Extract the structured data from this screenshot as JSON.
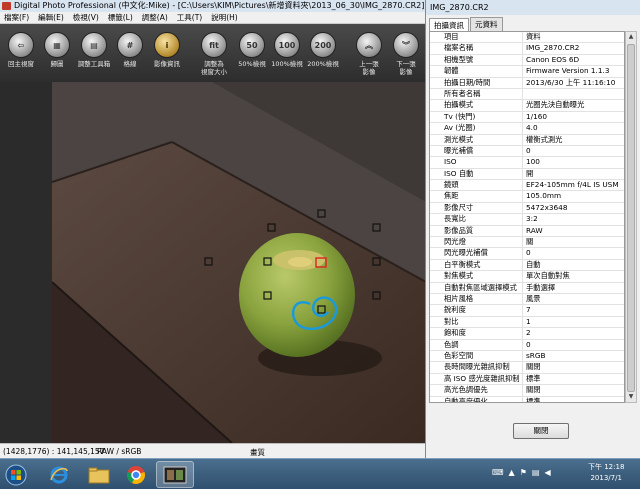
{
  "window": {
    "title": "Digital Photo Professional (中文化:Mike) - [C:\\Users\\KIM\\Pictures\\新增資料夾\\2013_06_30\\IMG_2870.CR2]"
  },
  "menu": [
    "檔案(F)",
    "編輯(E)",
    "檢視(V)",
    "標籤(L)",
    "調整(A)",
    "工具(T)",
    "說明(H)"
  ],
  "toolbar": {
    "buttons": [
      {
        "label": "回主視窗",
        "glyph": "⇦"
      },
      {
        "label": "歸圖",
        "glyph": "▦"
      },
      {
        "label": "調整工具箱",
        "glyph": "▤"
      },
      {
        "label": "格線",
        "glyph": "#"
      },
      {
        "label": "影像資訊",
        "glyph": "i"
      },
      {
        "label": "調整為\n視窗大小",
        "glyph": "fit"
      },
      {
        "label": "50%檢視",
        "glyph": "50"
      },
      {
        "label": "100%檢視",
        "glyph": "100"
      },
      {
        "label": "200%檢視",
        "glyph": "200"
      },
      {
        "label": "上一張\n影像",
        "glyph": "︽"
      },
      {
        "label": "下一張\n影像",
        "glyph": "︾"
      }
    ]
  },
  "status": {
    "coords": "(1428,1776) : 141,145,157",
    "profile": "RAW / sRGB",
    "quality": "畫質"
  },
  "info_panel": {
    "title": "IMG_2870.CR2",
    "tabs": [
      "拍攝資訊",
      "元資料"
    ],
    "header": {
      "key": "項目",
      "value": "資料"
    },
    "rows": [
      {
        "k": "檔案名稱",
        "v": "IMG_2870.CR2"
      },
      {
        "k": "相機型號",
        "v": "Canon EOS 6D"
      },
      {
        "k": "韌體",
        "v": "Firmware Version 1.1.3"
      },
      {
        "k": "拍攝日期/時間",
        "v": "2013/6/30 上午 11:16:10"
      },
      {
        "k": "所有者名稱",
        "v": ""
      },
      {
        "k": "拍攝模式",
        "v": "光圈先決自動曝光"
      },
      {
        "k": "Tv (快門)",
        "v": "1/160"
      },
      {
        "k": "Av (光圈)",
        "v": "4.0"
      },
      {
        "k": "測光模式",
        "v": "權衡式測光"
      },
      {
        "k": "曝光補償",
        "v": "0"
      },
      {
        "k": "ISO",
        "v": "100"
      },
      {
        "k": "ISO 自動",
        "v": "開"
      },
      {
        "k": "鏡頭",
        "v": "EF24-105mm f/4L IS USM"
      },
      {
        "k": "焦距",
        "v": "105.0mm"
      },
      {
        "k": "影像尺寸",
        "v": "5472x3648"
      },
      {
        "k": "長寬比",
        "v": "3:2"
      },
      {
        "k": "影像品質",
        "v": "RAW"
      },
      {
        "k": "閃光燈",
        "v": "關"
      },
      {
        "k": "閃光曝光補償",
        "v": "0"
      },
      {
        "k": "白平衡模式",
        "v": "自動"
      },
      {
        "k": "對焦模式",
        "v": "單次自動對焦"
      },
      {
        "k": "自動對焦區域選擇模式",
        "v": "手動選擇"
      },
      {
        "k": "相片風格",
        "v": "風景"
      },
      {
        "k": "銳利度",
        "v": "7"
      },
      {
        "k": "對比",
        "v": "1"
      },
      {
        "k": "飽和度",
        "v": "2"
      },
      {
        "k": "色調",
        "v": "0"
      },
      {
        "k": "色彩空間",
        "v": "sRGB"
      },
      {
        "k": "長時間曝光雜訊抑制",
        "v": "關閉"
      },
      {
        "k": "高 ISO 感光度雜訊抑制",
        "v": "標準"
      },
      {
        "k": "高光色調優先",
        "v": "關閉"
      },
      {
        "k": "自動亮度優化",
        "v": "標準"
      }
    ],
    "close_label": "關閉"
  },
  "taskbar": {
    "time": "下午 12:18",
    "date": "2013/7/1"
  }
}
